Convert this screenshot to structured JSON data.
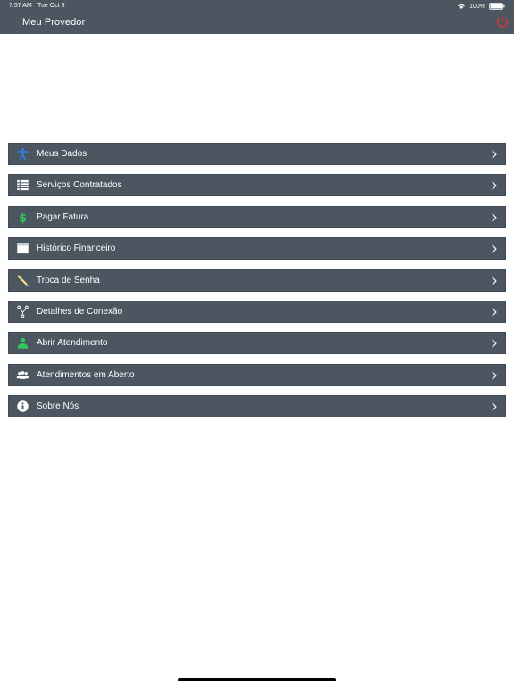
{
  "status_bar": {
    "time": "7:57 AM",
    "date": "Tue Oct 8",
    "battery": "100%"
  },
  "nav": {
    "title": "Meu Provedor",
    "power_icon": "power-icon",
    "power_color": "#e0333a"
  },
  "colors": {
    "bar": "#4b5661",
    "accent_blue": "#2f80ed",
    "accent_green": "#31c75b",
    "accent_yellow": "#f2e37a"
  },
  "menu": {
    "items": [
      {
        "label": "Meus Dados",
        "icon": "person-icon"
      },
      {
        "label": "Serviços Contratados",
        "icon": "list-icon"
      },
      {
        "label": "Pagar Fatura",
        "icon": "dollar-icon"
      },
      {
        "label": "Histórico Financeiro",
        "icon": "calendar-icon"
      },
      {
        "label": "Troca de Senha",
        "icon": "key-icon"
      },
      {
        "label": "Detalhes de Conexão",
        "icon": "network-icon"
      },
      {
        "label": "Abrir Atendimento",
        "icon": "user-add-icon"
      },
      {
        "label": "Atendimentos em Aberto",
        "icon": "group-icon"
      },
      {
        "label": "Sobre Nós",
        "icon": "info-icon"
      }
    ]
  }
}
